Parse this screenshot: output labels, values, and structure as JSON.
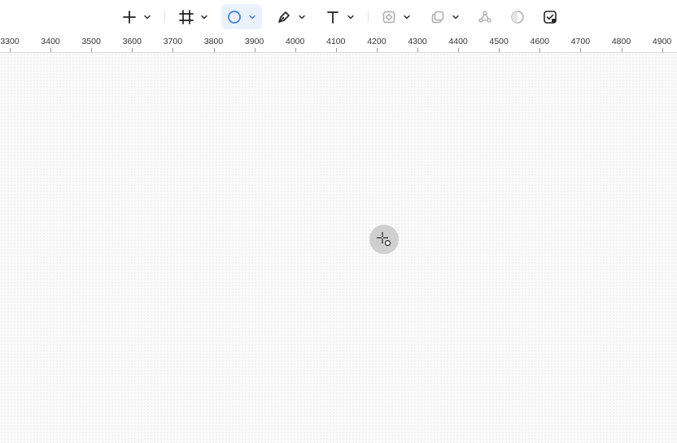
{
  "toolbar": {
    "tools": [
      {
        "name": "add-tool",
        "icon": "plus-icon",
        "has_dropdown": true,
        "active": false
      },
      {
        "name": "frame-tool",
        "icon": "frame-icon",
        "has_dropdown": true,
        "active": false
      },
      {
        "name": "ellipse-tool",
        "icon": "circle-icon",
        "has_dropdown": true,
        "active": true
      },
      {
        "name": "pen-tool",
        "icon": "pen-nib-icon",
        "has_dropdown": true,
        "active": false
      },
      {
        "name": "text-tool",
        "icon": "text-icon",
        "has_dropdown": true,
        "active": false
      },
      {
        "name": "component-tool",
        "icon": "component-icon",
        "has_dropdown": true,
        "active": false,
        "disabled": true
      },
      {
        "name": "boolean-tool",
        "icon": "boolean-union-icon",
        "has_dropdown": true,
        "active": false,
        "disabled": true
      },
      {
        "name": "vector-network-tool",
        "icon": "vector-nodes-icon",
        "has_dropdown": false,
        "active": false,
        "disabled": true
      },
      {
        "name": "mask-tool",
        "icon": "mask-circle-icon",
        "has_dropdown": false,
        "active": false,
        "disabled": true
      },
      {
        "name": "export-tool",
        "icon": "export-check-icon",
        "has_dropdown": false,
        "active": false
      }
    ],
    "accent_color": "#3b7ddd"
  },
  "ruler": {
    "labels": [
      "3300",
      "3400",
      "3500",
      "3600",
      "3700",
      "3800",
      "3900",
      "4000",
      "4100",
      "4200",
      "4300",
      "4400",
      "4500",
      "4600",
      "4700",
      "4800",
      "4900"
    ]
  },
  "canvas": {
    "background": "dotted-grid",
    "cursor": "crosshair-ellipse-cursor"
  }
}
